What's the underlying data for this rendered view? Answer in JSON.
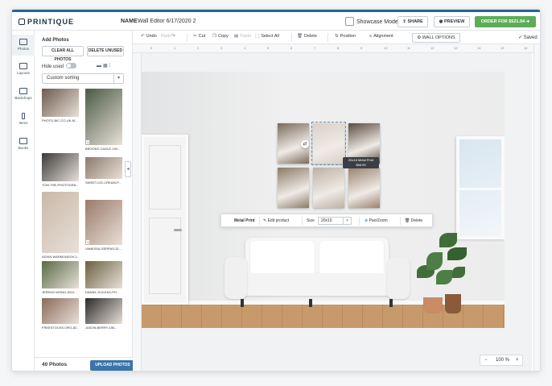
{
  "app": {
    "logo": "PRINTIQUE",
    "name_label": "NAME",
    "name_value": "Wall Editor 6/17/2020 2",
    "showcase_label": "Showcase Mode",
    "share_label": "SHARE",
    "preview_label": "PREVIEW",
    "order_label": "ORDER FOR $521.94"
  },
  "toolbar": {
    "undo": "Undo",
    "redo": "Redo",
    "cut": "Cut",
    "copy": "Copy",
    "paste": "Paste",
    "select_all": "Select All",
    "delete": "Delete",
    "position": "Position",
    "alignment": "Alignment",
    "wall_options": "WALL OPTIONS",
    "saved": "Saved"
  },
  "rail": [
    {
      "label": "Photos"
    },
    {
      "label": "Layouts"
    },
    {
      "label": "Backdrops"
    },
    {
      "label": "Items"
    },
    {
      "label": "Books"
    }
  ],
  "panel": {
    "title": "Add Photos",
    "clear_all": "CLEAR ALL PHOTOS",
    "delete_unused": "DELETE UNUSED",
    "hide_used": "Hide used",
    "sort": "Custom sorting",
    "count": "40 Photos",
    "upload": "UPLOAD PHOTOS"
  },
  "photos": [
    {
      "caption": "PHOTO-BIC-CO-UK-M...",
      "color": "#6d5a4c"
    },
    {
      "caption": "BROOKE-CAGLE-193...",
      "color": "#4a5a44",
      "badge": "1"
    },
    {
      "caption": "TOM-THE-PHOTOGRA...",
      "color": "#3a3a3a"
    },
    {
      "caption": "SWEET-ICE-CREAM-P...",
      "color": "#8c7a6c"
    },
    {
      "caption": "ADVIN-WARMUNDOV-1...",
      "color": "#c9b8a8"
    },
    {
      "caption": "VANESSA-SERPAS-32...",
      "color": "#9a7a6a",
      "badge": "1"
    },
    {
      "caption": "JEREMY-WONG-3012...",
      "color": "#5a6a44"
    },
    {
      "caption": "DANIEL-SOLEAS-PH...",
      "color": "#6a6040"
    },
    {
      "caption": "FREESTOCKS-ORG-82...",
      "color": "#8a6a5a"
    },
    {
      "caption": "JASON-BERRY-156...",
      "color": "#2a2a2a"
    }
  ],
  "ruler_ticks": [
    "0",
    "1",
    "2",
    "3",
    "4",
    "5",
    "6",
    "7",
    "8",
    "9",
    "10",
    "11",
    "12",
    "13",
    "14",
    "15",
    "16"
  ],
  "wall": {
    "tooltip_title": "20x16 Metal Print",
    "tooltip_price": "$66.99",
    "frame_colors": [
      "#7a6a5c",
      "#d8d0c8",
      "#5a4a40",
      "#8a7a68",
      "#bcb0a4",
      "#9a8270"
    ]
  },
  "context": {
    "type": "Metal Print",
    "edit": "Edit product",
    "size_label": "Size",
    "size_value": "20x16",
    "panzoom": "Pan/Zoom",
    "delete": "Delete"
  },
  "zoom": {
    "minus": "−",
    "value": "100 %",
    "plus": "+"
  }
}
